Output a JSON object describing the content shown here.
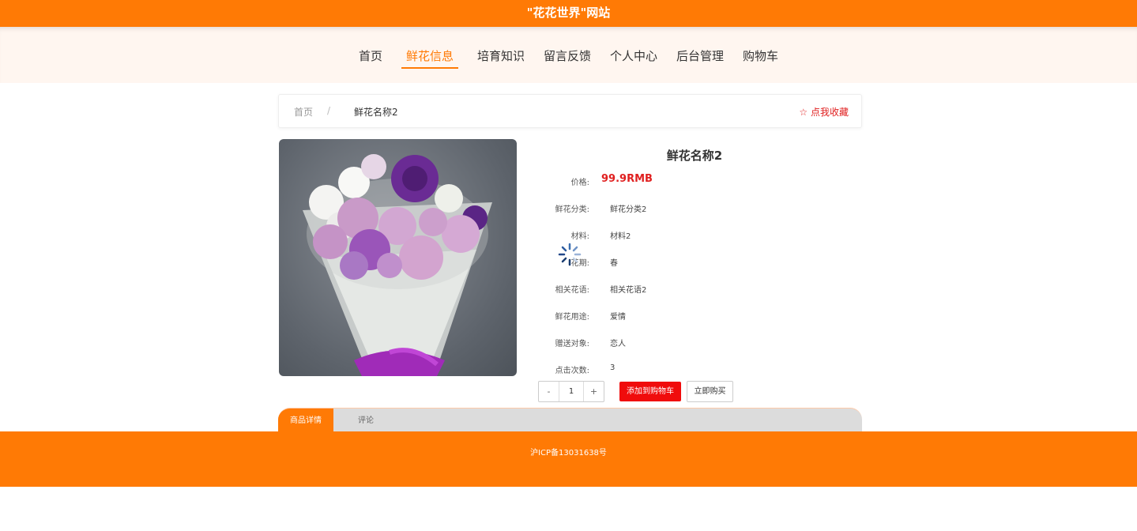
{
  "header": {
    "site_title": "\"花花世界\"网站"
  },
  "nav": {
    "items": [
      {
        "label": "首页"
      },
      {
        "label": "鲜花信息"
      },
      {
        "label": "培育知识"
      },
      {
        "label": "留言反馈"
      },
      {
        "label": "个人中心"
      },
      {
        "label": "后台管理"
      },
      {
        "label": "购物车"
      }
    ]
  },
  "breadcrumb": {
    "home": "首页",
    "separator": "/",
    "current": "鲜花名称2",
    "favorite": "☆ 点我收藏"
  },
  "product": {
    "name": "鲜花名称2",
    "price_label": "价格:",
    "price": "99.9RMB",
    "fields": [
      {
        "label": "鲜花分类:",
        "value": "鲜花分类2"
      },
      {
        "label": "材料:",
        "value": "材料2"
      },
      {
        "label": "花期:",
        "value": "春"
      },
      {
        "label": "相关花语:",
        "value": "相关花语2"
      },
      {
        "label": "鲜花用途:",
        "value": "爱情"
      },
      {
        "label": "赠送对象:",
        "value": "恋人"
      },
      {
        "label": "点击次数:",
        "value": "3"
      }
    ]
  },
  "quantity": {
    "minus": "-",
    "value": "1",
    "plus": "+"
  },
  "actions": {
    "add_to_cart": "添加到购物车",
    "buy_now": "立即购买"
  },
  "tabs": {
    "details": "商品详情",
    "comments": "评论"
  },
  "footer": {
    "icp": "沪ICP备13031638号"
  },
  "colors": {
    "brand": "#ff7a05",
    "price": "#e02020",
    "cart_button": "#f00c0c"
  }
}
